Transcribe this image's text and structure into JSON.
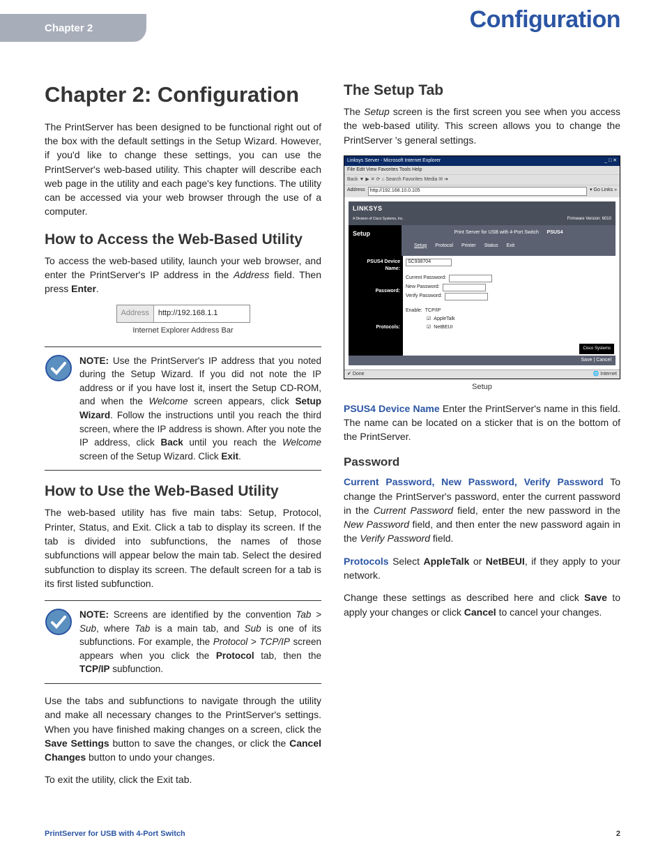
{
  "header": {
    "chapter_label": "Chapter 2",
    "top_title": "Configuration"
  },
  "left": {
    "h1": "Chapter 2: Configuration",
    "intro": "The PrintServer has been designed to be functional right out of the box with the default settings in the Setup Wizard. However, if you'd like to change these settings, you can use the PrintServer's web-based utility. This chapter will describe each web page in the utility and each page's key functions. The utility can be accessed via your web browser through the use of a computer.",
    "h2_access": "How to Access the Web-Based Utility",
    "access_p": "To access the web-based utility, launch your web browser, and enter the PrintServer's IP address in the ",
    "access_italic": "Address",
    "access_p2": " field. Then press ",
    "access_bold": "Enter",
    "addr_label": "Address",
    "addr_value": "http://192.168.1.1",
    "addr_caption": "Internet Explorer Address Bar",
    "note1": "Use the PrintServer's IP address that you noted during the Setup Wizard. If you did not note the IP address or if you have lost it, insert the Setup CD-ROM, and when the ",
    "note1_b1": "Setup Wizard",
    "note1_mid": ". Follow the instructions until you reach the third screen, where the IP address is shown. After you note the IP address, click ",
    "note1_b2": "Back",
    "note1_mid2": " until you reach the ",
    "note1_i2": "Welcome",
    "note1_end": " screen of the Setup Wizard. Click ",
    "note1_b3": "Exit",
    "note1_i1": "Welcome",
    "note1_pre_mid": " screen appears, click ",
    "note_label": "NOTE:",
    "h2_use": "How to Use the Web-Based Utility",
    "use_p": "The web-based utility has five main tabs: Setup, Protocol, Printer, Status, and Exit. Click a tab to display its screen. If the tab is divided into subfunctions, the names of those subfunctions will appear below the main tab. Select the desired subfunction to display its screen. The default screen for a tab is its first listed subfunction.",
    "note2": "Screens are identified by the convention ",
    "note2_i1": "Tab > Sub",
    "note2_mid1": ", where ",
    "note2_i2": "Tab",
    "note2_mid2": " is a main tab, and ",
    "note2_i3": "Sub",
    "note2_mid3": " is one of its subfunctions. For example, the ",
    "note2_i4": "Protocol > TCP/IP",
    "note2_mid4": " screen appears when you click the ",
    "note2_b1": "Protocol",
    "note2_mid5": " tab, then the ",
    "note2_b2": "TCP/IP",
    "note2_end": " subfunction.",
    "use_p2": "Use the tabs and subfunctions to navigate through the utility and make all necessary changes to the PrintServer's settings. When you have finished making changes on a screen, click the ",
    "use_b1": "Save Settings",
    "use_mid1": " button to save the changes, or click the ",
    "use_b2": "Cancel Changes",
    "use_end": " button to undo your changes.",
    "use_p3": "To exit the utility, click the Exit tab."
  },
  "right": {
    "h2_setup": "The Setup Tab",
    "setup_p": "The ",
    "setup_i": "Setup",
    "setup_p2": " screen is the first screen you see when you access the web-based utility. This screen allows you to change the PrintServer 's general settings.",
    "screenshot": {
      "titlebar": "Linksys Server - Microsoft Internet Explorer",
      "menubar": "File   Edit   View   Favorites   Tools   Help",
      "toolbar": "Back  ▼  ▶  ✕  ⟳  ⌂   Search   Favorites   Media   ✉  ➜",
      "addr_label": "Address",
      "addr_a": "http://192.168.10.0.105",
      "addr_go": "Go",
      "addr_links": "Links",
      "brand": "LINKSYS",
      "brand_sub": "A Division of Cisco Systems, Inc.",
      "fw": "Firmware Version: 6010",
      "prod_strip": "Print Server for USB with 4-Port Switch",
      "prod_model": "PSUS4",
      "tab_setup": "Setup",
      "subtabs": [
        "Setup",
        "Protocol",
        "Printer",
        "Status",
        "Exit"
      ],
      "row_device": "PSUS4 Device Name:",
      "device_val": "SC938704",
      "row_pwd": "Password:",
      "pwd_cur": "Current Password:",
      "pwd_new": "New Password:",
      "pwd_ver": "Verify Password:",
      "row_proto": "Protocols:",
      "proto_enable": "Enable:",
      "proto_tcp": "TCP/IP",
      "proto_at": "AppleTalk",
      "proto_nb": "NetBEUI",
      "btn_save": "Save",
      "btn_cancel": "Cancel",
      "cisco": "Cisco Systems",
      "status_done": "Done",
      "status_inet": "Internet"
    },
    "ss_caption": "Setup",
    "kw_device": "PSUS4 Device Name",
    "device_p": "  Enter the PrintServer's name in this field. The name can be located on a sticker that is on the bottom of the PrintServer.",
    "h3_pwd": "Password",
    "kw_pwd": "Current Password, New Password, Verify Password",
    "pwd_p": "  To change the PrintServer's password, enter the current password in the ",
    "pwd_i1": "Current Password",
    "pwd_mid1": " field, enter the new password in the ",
    "pwd_i2": "New Password",
    "pwd_mid2": " field, and then enter the new password again in the ",
    "pwd_i3": "Verify Password",
    "pwd_end": " field.",
    "kw_proto": "Protocols",
    "proto_p": "  Select ",
    "proto_b1": "AppleTalk",
    "proto_mid": " or ",
    "proto_b2": "NetBEUI",
    "proto_end": ", if they apply to your network.",
    "save_p": "Change these settings as described here and click ",
    "save_b1": "Save",
    "save_mid": " to apply your changes or click ",
    "save_b2": "Cancel",
    "save_end": " to cancel your changes."
  },
  "footer": {
    "product": "PrintServer for USB with 4-Port Switch",
    "page": "2"
  }
}
